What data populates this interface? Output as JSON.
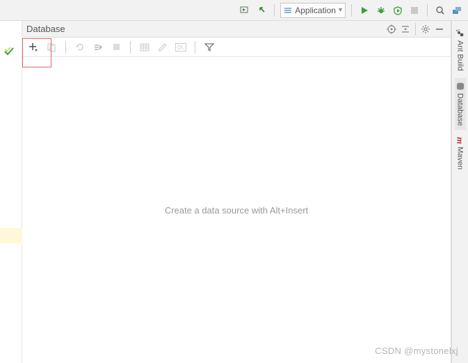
{
  "toolbar": {
    "run_config_label": "Application"
  },
  "database_panel": {
    "title": "Database",
    "empty_hint": "Create a data source with Alt+Insert"
  },
  "side_tabs": {
    "ant": "Ant Build",
    "database": "Database",
    "maven": "Maven"
  },
  "watermark": "CSDN @mystonelxj"
}
